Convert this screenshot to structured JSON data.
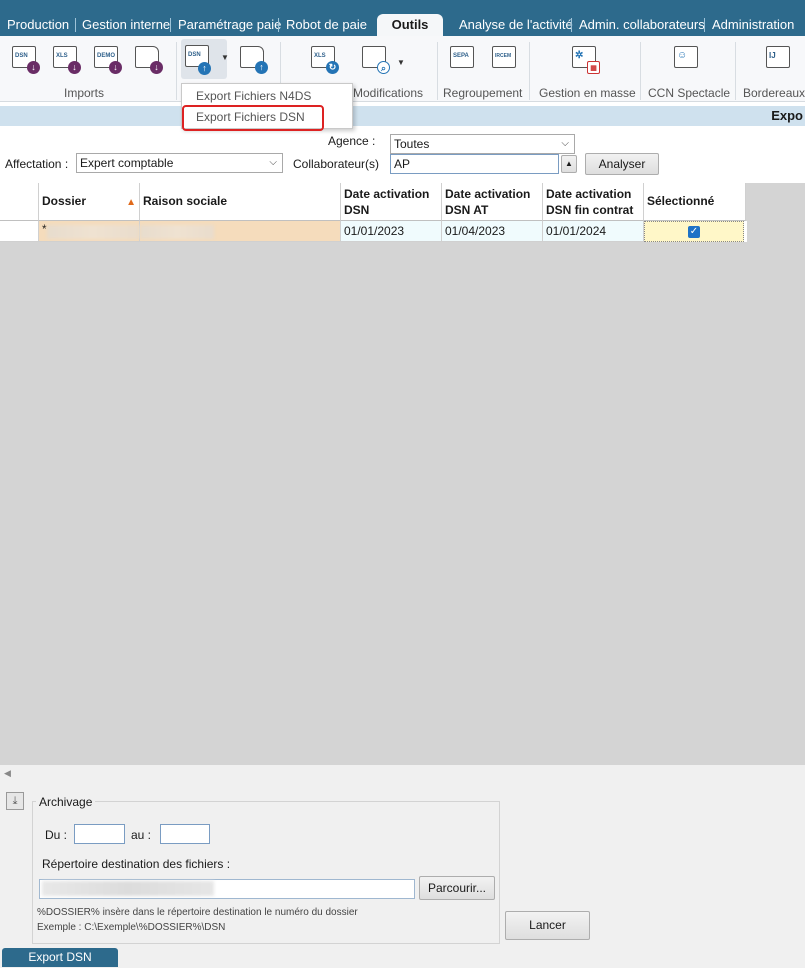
{
  "tabs": [
    "Production",
    "Gestion interne",
    "Paramétrage paie",
    "Robot de paie",
    "Outils",
    "Analyse de l'activité",
    "Admin. collaborateurs",
    "Administration"
  ],
  "active_tab": "Outils",
  "ribbon": {
    "icon_tags": [
      "DSN",
      "XLS",
      "DEMO",
      "",
      "DSN",
      "",
      "XLS",
      "",
      "SEPA",
      "IRCEM",
      "",
      "",
      "IJ"
    ],
    "groups": [
      "Imports",
      "Modifications",
      "Regroupement",
      "Gestion en masse",
      "CCN Spectacle",
      "Bordereaux"
    ]
  },
  "dropdown_menu": {
    "items": [
      "Export Fichiers N4DS",
      "Export Fichiers DSN"
    ],
    "highlighted": "Export Fichiers DSN"
  },
  "header_strip_title": "Expo",
  "filters": {
    "agence_label": "Agence :",
    "agence_value": "Toutes",
    "affectation_label": "Affectation :",
    "affectation_value": "Expert comptable",
    "collaborateur_label": "Collaborateur(s)",
    "collaborateur_value": "AP",
    "analyser_label": "Analyser"
  },
  "grid": {
    "headers": [
      "Dossier",
      "Raison sociale",
      "Date activation DSN",
      "Date activation DSN AT",
      "Date activation DSN fin contrat",
      "Sélectionné"
    ],
    "header_lines": [
      [
        "Dossier"
      ],
      [
        "Raison sociale"
      ],
      [
        "Date activation",
        "DSN"
      ],
      [
        "Date activation",
        "DSN AT"
      ],
      [
        "Date activation",
        "DSN fin contrat"
      ],
      [
        "Sélectionné"
      ]
    ],
    "rows": [
      {
        "dossier": "*",
        "raison_sociale": "",
        "dsn": "01/01/2023",
        "dsn_at": "01/04/2023",
        "dsn_fin_contrat": "01/01/2024",
        "selected": true
      }
    ]
  },
  "archivage": {
    "legend": "Archivage",
    "du_label": "Du :",
    "du_value": "",
    "au_label": "au :",
    "au_value": "",
    "repertoire_label": "Répertoire destination des fichiers :",
    "repertoire_value": "",
    "parcourir_label": "Parcourir...",
    "note_line1": "%DOSSIER% insère dans le répertoire destination le numéro du dossier",
    "note_line2": "Exemple : C:\\Exemple\\%DOSSIER%\\DSN"
  },
  "lancer_label": "Lancer",
  "bottom_tab": "Export DSN",
  "colors": {
    "accent": "#2d6a8c",
    "strip": "#cfe1ee",
    "highlight": "#dd2222",
    "selected_cell": "#fff7c8"
  }
}
